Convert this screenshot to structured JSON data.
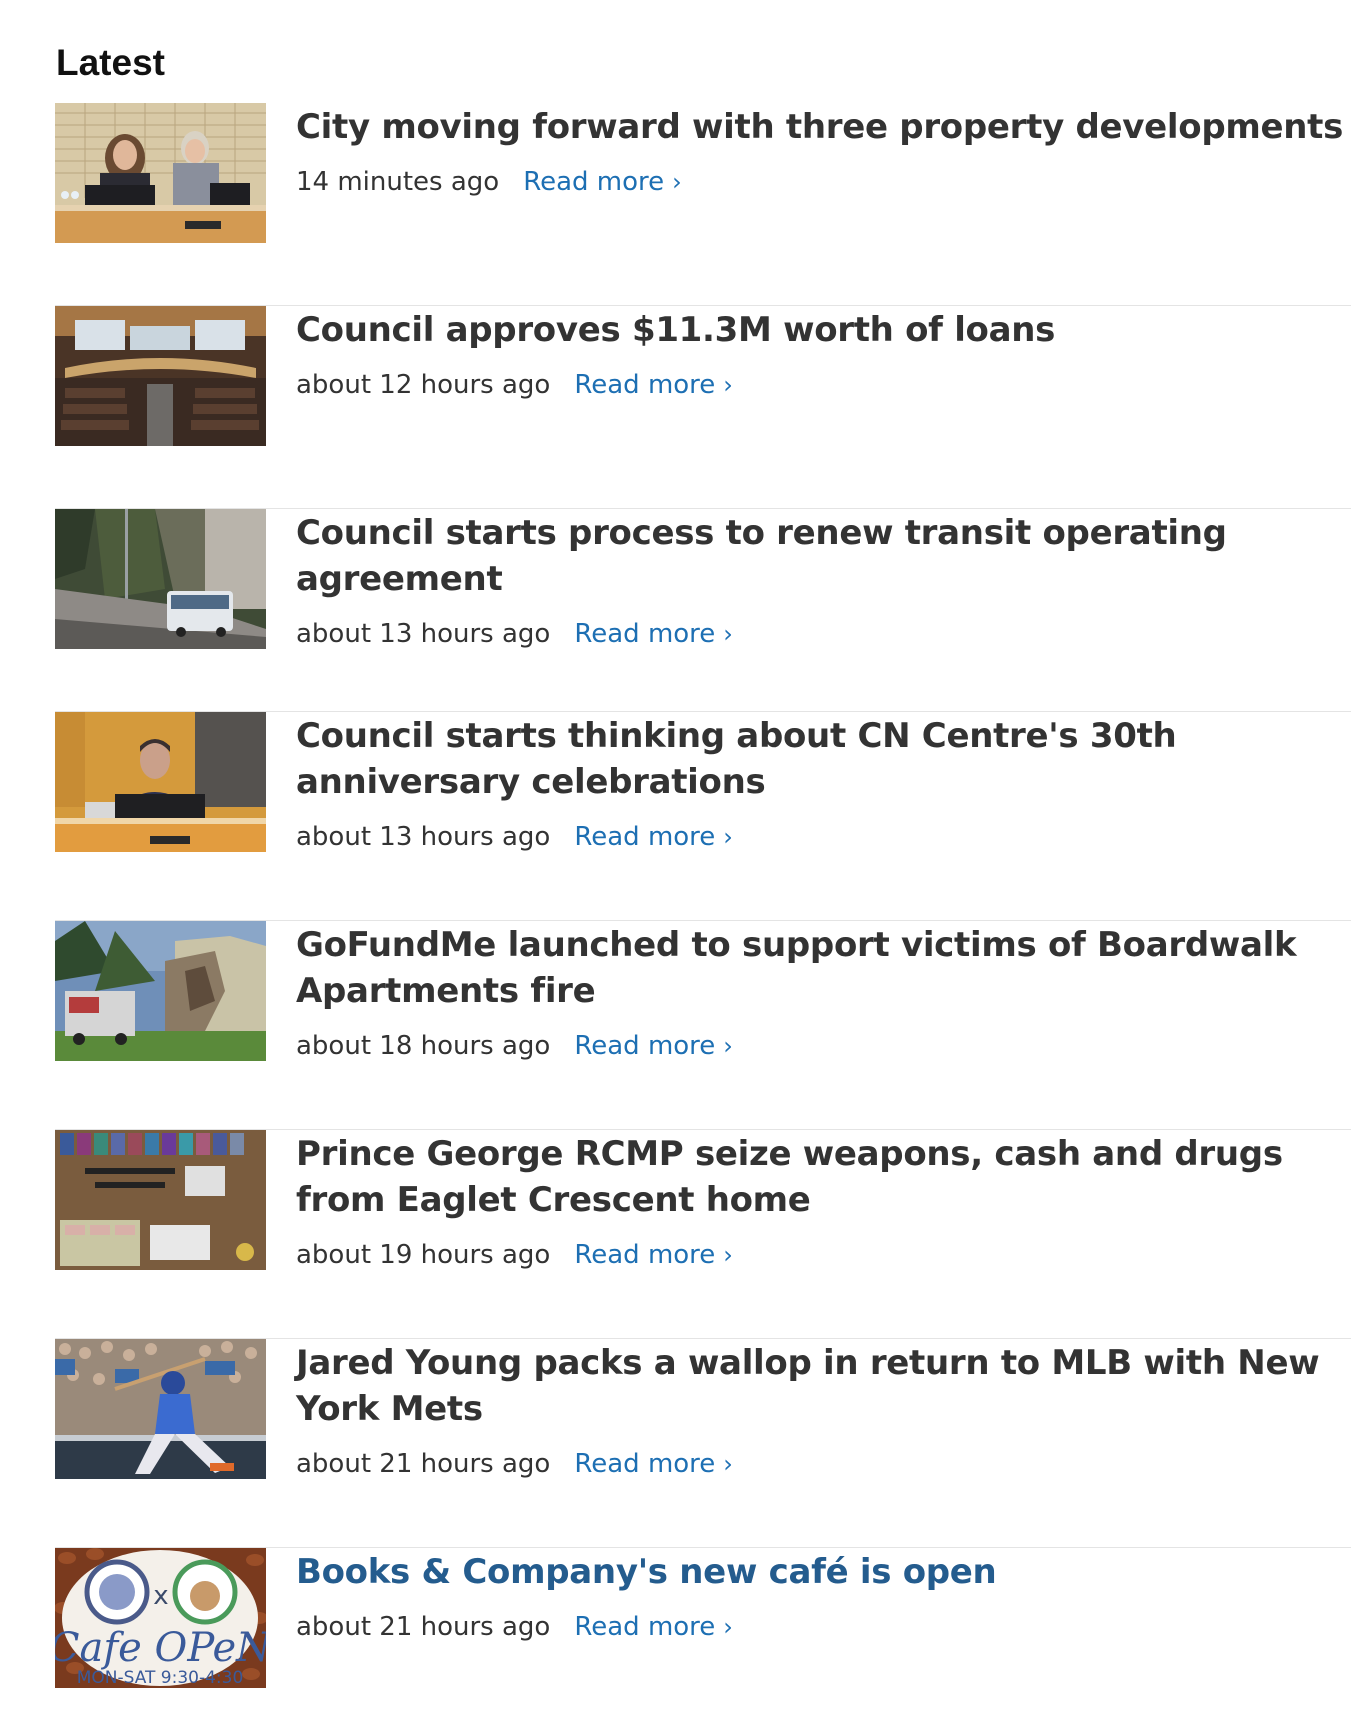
{
  "section": {
    "title": "Latest"
  },
  "colors": {
    "headline": "#333333",
    "visited_headline": "#245c8e",
    "link": "#1d6fb3",
    "divider": "#e4e4e4"
  },
  "read_more_icon": "chevron-right-icon",
  "articles": [
    {
      "headline": "City moving forward with three property developments",
      "time": "14 minutes ago",
      "read_more": "Read more",
      "chevron": "›"
    },
    {
      "headline": "Council approves $11.3M worth of loans",
      "time": "about 12 hours ago",
      "read_more": "Read more",
      "chevron": "›"
    },
    {
      "headline": "Council starts process to renew transit operating agreement",
      "time": "about 13 hours ago",
      "read_more": "Read more",
      "chevron": "›"
    },
    {
      "headline": "Council starts thinking about CN Centre's 30th anniversary celebrations",
      "time": "about 13 hours ago",
      "read_more": "Read more",
      "chevron": "›"
    },
    {
      "headline": "GoFundMe launched to support victims of Boardwalk Apartments fire",
      "time": "about 18 hours ago",
      "read_more": "Read more",
      "chevron": "›"
    },
    {
      "headline": "Prince George RCMP seize weapons, cash and drugs from Eaglet Crescent home",
      "time": "about 19 hours ago",
      "read_more": "Read more",
      "chevron": "›"
    },
    {
      "headline": "Jared Young packs a wallop in return to MLB with New York Mets",
      "time": "about 21 hours ago",
      "read_more": "Read more",
      "chevron": "›"
    },
    {
      "headline": "Books & Company's new café is open",
      "time": "about 21 hours ago",
      "read_more": "Read more",
      "chevron": "›",
      "thumb_text": {
        "x": "x",
        "sign": "Cafe OPeN",
        "hours": "MON-SAT 9:30-4:30"
      }
    }
  ]
}
